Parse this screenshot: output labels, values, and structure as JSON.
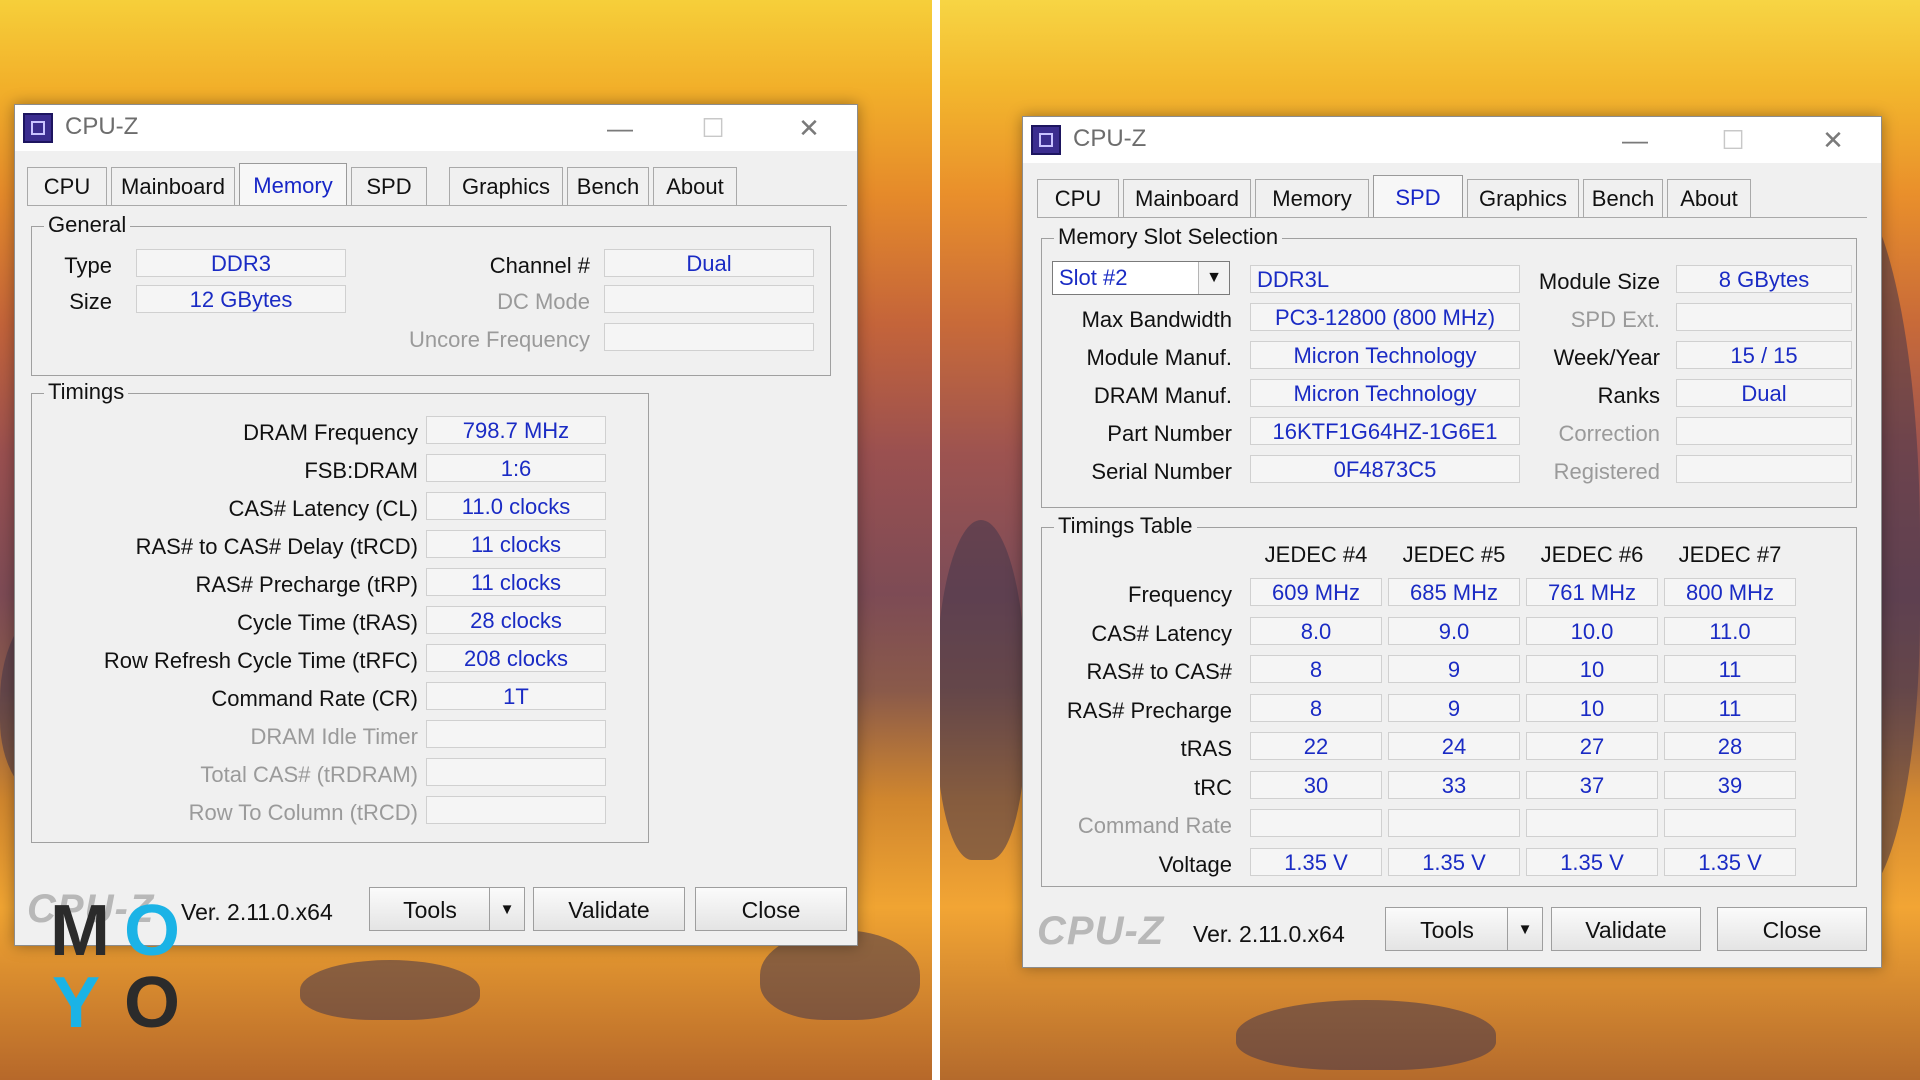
{
  "left_window": {
    "title": "CPU-Z",
    "tabs": [
      "CPU",
      "Mainboard",
      "Memory",
      "SPD",
      "Graphics",
      "Bench",
      "About"
    ],
    "active_tab": "Memory",
    "general": {
      "title": "General",
      "type_label": "Type",
      "type_value": "DDR3",
      "size_label": "Size",
      "size_value": "12 GBytes",
      "channel_label": "Channel #",
      "channel_value": "Dual",
      "dc_mode_label": "DC Mode",
      "dc_mode_value": "",
      "uncore_label": "Uncore Frequency",
      "uncore_value": ""
    },
    "timings": {
      "title": "Timings",
      "rows": [
        {
          "label": "DRAM Frequency",
          "value": "798.7 MHz",
          "dim": false
        },
        {
          "label": "FSB:DRAM",
          "value": "1:6",
          "dim": false
        },
        {
          "label": "CAS# Latency (CL)",
          "value": "11.0 clocks",
          "dim": false
        },
        {
          "label": "RAS# to CAS# Delay (tRCD)",
          "value": "11 clocks",
          "dim": false
        },
        {
          "label": "RAS# Precharge (tRP)",
          "value": "11 clocks",
          "dim": false
        },
        {
          "label": "Cycle Time (tRAS)",
          "value": "28 clocks",
          "dim": false
        },
        {
          "label": "Row Refresh Cycle Time (tRFC)",
          "value": "208 clocks",
          "dim": false
        },
        {
          "label": "Command Rate (CR)",
          "value": "1T",
          "dim": false
        },
        {
          "label": "DRAM Idle Timer",
          "value": "",
          "dim": true
        },
        {
          "label": "Total CAS# (tRDRAM)",
          "value": "",
          "dim": true
        },
        {
          "label": "Row To Column (tRCD)",
          "value": "",
          "dim": true
        }
      ]
    },
    "footer": {
      "logo": "CPU-Z",
      "version": "Ver. 2.11.0.x64",
      "tools": "Tools",
      "validate": "Validate",
      "close": "Close"
    }
  },
  "right_window": {
    "title": "CPU-Z",
    "tabs": [
      "CPU",
      "Mainboard",
      "Memory",
      "SPD",
      "Graphics",
      "Bench",
      "About"
    ],
    "active_tab": "SPD",
    "slot": {
      "title": "Memory Slot Selection",
      "selected_slot": "Slot #2",
      "module_type": "DDR3L",
      "module_size_label": "Module Size",
      "module_size_value": "8 GBytes",
      "max_bandwidth_label": "Max Bandwidth",
      "max_bandwidth_value": "PC3-12800 (800 MHz)",
      "spd_ext_label": "SPD Ext.",
      "spd_ext_value": "",
      "module_manuf_label": "Module Manuf.",
      "module_manuf_value": "Micron Technology",
      "week_year_label": "Week/Year",
      "week_year_value": "15 / 15",
      "dram_manuf_label": "DRAM Manuf.",
      "dram_manuf_value": "Micron Technology",
      "ranks_label": "Ranks",
      "ranks_value": "Dual",
      "part_number_label": "Part Number",
      "part_number_value": "16KTF1G64HZ-1G6E1",
      "correction_label": "Correction",
      "correction_value": "",
      "serial_number_label": "Serial Number",
      "serial_number_value": "0F4873C5",
      "registered_label": "Registered",
      "registered_value": ""
    },
    "timings_table": {
      "title": "Timings Table",
      "columns": [
        "JEDEC #4",
        "JEDEC #5",
        "JEDEC #6",
        "JEDEC #7"
      ],
      "rows": [
        {
          "label": "Frequency",
          "values": [
            "609 MHz",
            "685 MHz",
            "761 MHz",
            "800 MHz"
          ],
          "dim": false
        },
        {
          "label": "CAS# Latency",
          "values": [
            "8.0",
            "9.0",
            "10.0",
            "11.0"
          ],
          "dim": false
        },
        {
          "label": "RAS# to CAS#",
          "values": [
            "8",
            "9",
            "10",
            "11"
          ],
          "dim": false
        },
        {
          "label": "RAS# Precharge",
          "values": [
            "8",
            "9",
            "10",
            "11"
          ],
          "dim": false
        },
        {
          "label": "tRAS",
          "values": [
            "22",
            "24",
            "27",
            "28"
          ],
          "dim": false
        },
        {
          "label": "tRC",
          "values": [
            "30",
            "33",
            "37",
            "39"
          ],
          "dim": false
        },
        {
          "label": "Command Rate",
          "values": [
            "",
            "",
            "",
            ""
          ],
          "dim": true
        },
        {
          "label": "Voltage",
          "values": [
            "1.35 V",
            "1.35 V",
            "1.35 V",
            "1.35 V"
          ],
          "dim": false
        }
      ]
    },
    "footer": {
      "logo": "CPU-Z",
      "version": "Ver. 2.11.0.x64",
      "tools": "Tools",
      "validate": "Validate",
      "close": "Close"
    }
  },
  "watermark": {
    "letters": [
      "M",
      "O",
      "Y",
      "O"
    ],
    "colors": [
      "#2b2b2b",
      "#1bb3e6",
      "#1bb3e6",
      "#2b2b2b"
    ]
  }
}
